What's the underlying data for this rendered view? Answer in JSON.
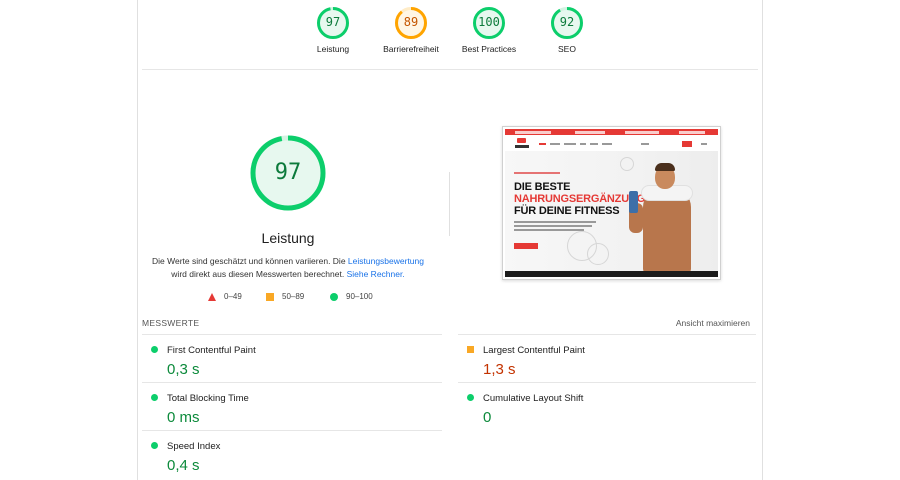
{
  "summary_gauges": [
    {
      "score": "97",
      "label": "Leistung",
      "color": "#0cce6b"
    },
    {
      "score": "89",
      "label": "Barrierefreiheit",
      "color": "#ffa400"
    },
    {
      "score": "100",
      "label": "Best Practices",
      "color": "#0cce6b"
    },
    {
      "score": "92",
      "label": "SEO",
      "color": "#0cce6b"
    }
  ],
  "performance": {
    "score": "97",
    "title": "Leistung",
    "desc_part1": "Die Werte sind geschätzt und können variieren. Die ",
    "desc_link1": "Leistungsbewertung",
    "desc_part2": "wird direkt aus diesen Messwerten berechnet. ",
    "desc_link2": "Siehe Rechner."
  },
  "legend": {
    "fail": "0–49",
    "average": "50–89",
    "pass": "90–100"
  },
  "screenshot": {
    "headline_1": "DIE BESTE",
    "headline_2": "NAHRUNGSERGÄNZUNG",
    "headline_3": "FÜR DEINE FITNESS"
  },
  "metrics": {
    "header": "MESSWERTE",
    "expand_label": "Ansicht maximieren",
    "items": [
      {
        "title": "First Contentful Paint",
        "value": "0,3 s",
        "status": "green"
      },
      {
        "title": "Largest Contentful Paint",
        "value": "1,3 s",
        "status": "orange"
      },
      {
        "title": "Total Blocking Time",
        "value": "0 ms",
        "status": "green"
      },
      {
        "title": "Cumulative Layout Shift",
        "value": "0",
        "status": "green"
      },
      {
        "title": "Speed Index",
        "value": "0,4 s",
        "status": "green"
      }
    ]
  }
}
